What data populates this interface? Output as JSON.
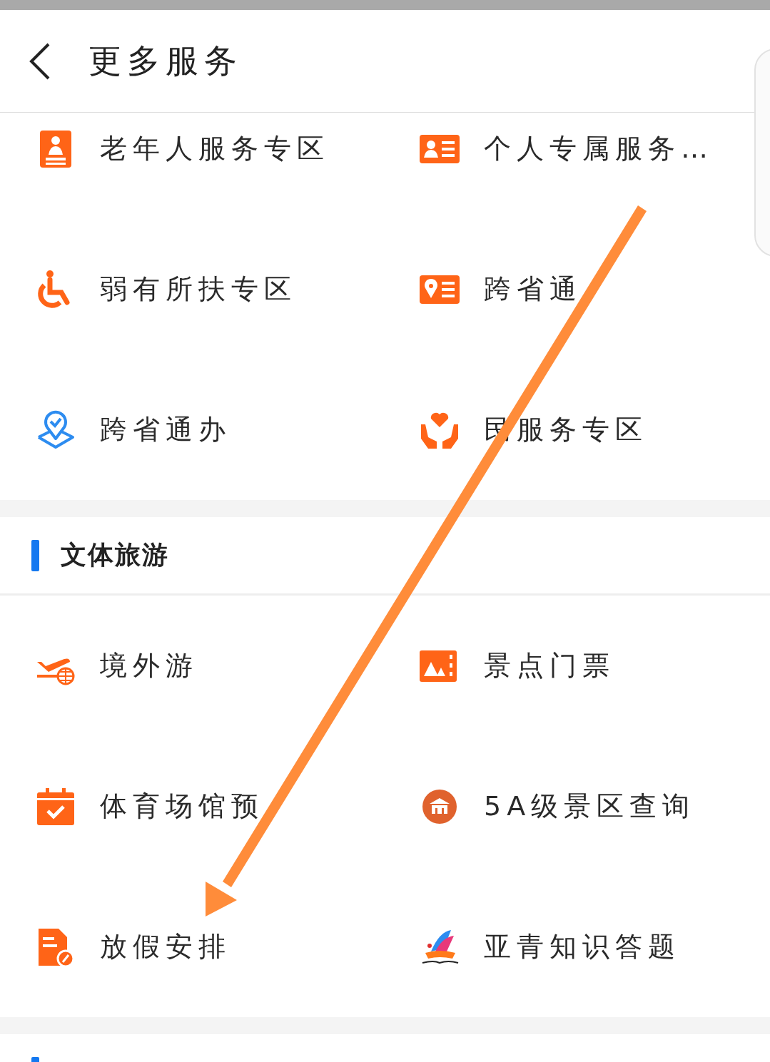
{
  "header": {
    "title": "更多服务"
  },
  "sections": [
    {
      "items": [
        {
          "label": "老年人服务专区"
        },
        {
          "label": "个人专属服务…"
        },
        {
          "label": "弱有所扶专区"
        },
        {
          "label": "跨省通"
        },
        {
          "label": "跨省通办"
        },
        {
          "label": "民服务专区"
        }
      ]
    },
    {
      "title": "文体旅游",
      "items": [
        {
          "label": "境外游"
        },
        {
          "label": "景点门票"
        },
        {
          "label": "体育场馆预"
        },
        {
          "label": "5A级景区查询"
        },
        {
          "label": "放假安排"
        },
        {
          "label": "亚青知识答题"
        }
      ]
    }
  ]
}
